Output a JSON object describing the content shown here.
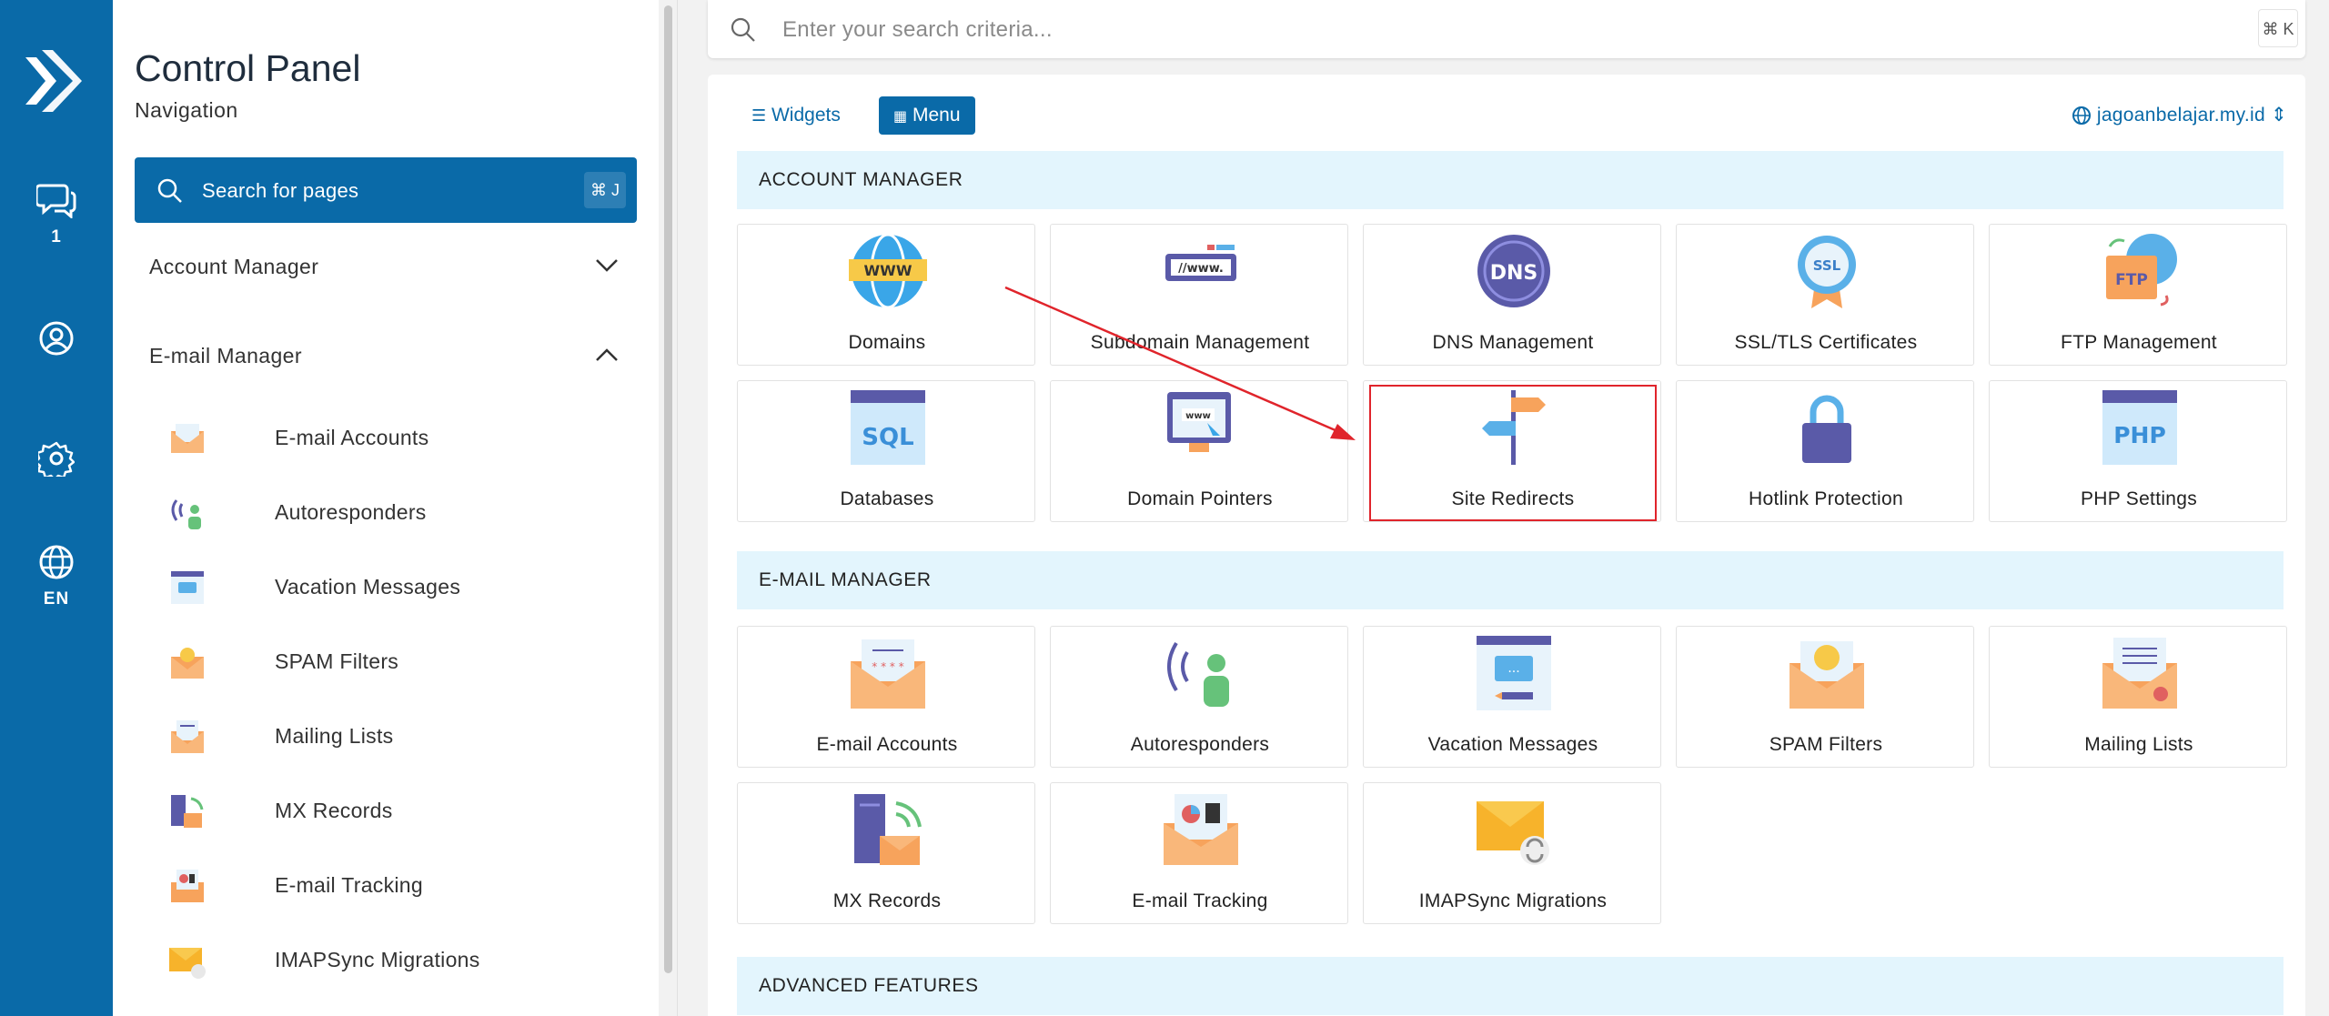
{
  "sidebar": {
    "title": "Control Panel",
    "subtitle": "Navigation",
    "search_placeholder": "Search for pages",
    "search_shortcut": "⌘ J",
    "sections": [
      {
        "label": "Account Manager",
        "expanded": false
      },
      {
        "label": "E-mail Manager",
        "expanded": true
      }
    ],
    "items": [
      {
        "label": "E-mail Accounts",
        "icon": "email-accounts-icon"
      },
      {
        "label": "Autoresponders",
        "icon": "autoresponder-icon"
      },
      {
        "label": "Vacation Messages",
        "icon": "vacation-messages-icon"
      },
      {
        "label": "SPAM Filters",
        "icon": "spam-filter-icon"
      },
      {
        "label": "Mailing Lists",
        "icon": "mailing-list-icon"
      },
      {
        "label": "MX Records",
        "icon": "mx-records-icon"
      },
      {
        "label": "E-mail Tracking",
        "icon": "email-tracking-icon"
      },
      {
        "label": "IMAPSync Migrations",
        "icon": "imapsync-icon"
      }
    ]
  },
  "rail": {
    "messages_count": "1",
    "language": "EN"
  },
  "topbar": {
    "search_placeholder": "Enter your search criteria...",
    "shortcut": "⌘ K"
  },
  "main": {
    "tabs": [
      {
        "label": "Widgets",
        "active": false
      },
      {
        "label": "Menu",
        "active": true
      }
    ],
    "domain": "jagoanbelajar.my.id",
    "sections": [
      {
        "title": "ACCOUNT MANAGER",
        "cards": [
          {
            "label": "Domains",
            "icon": "www-globe-icon"
          },
          {
            "label": "Subdomain Management",
            "icon": "subdomain-icon"
          },
          {
            "label": "DNS Management",
            "icon": "dns-icon"
          },
          {
            "label": "SSL/TLS Certificates",
            "icon": "ssl-badge-icon"
          },
          {
            "label": "FTP Management",
            "icon": "ftp-folder-icon"
          },
          {
            "label": "Databases",
            "icon": "sql-database-icon"
          },
          {
            "label": "Domain Pointers",
            "icon": "domain-pointer-icon"
          },
          {
            "label": "Site Redirects",
            "icon": "signpost-icon"
          },
          {
            "label": "Hotlink Protection",
            "icon": "padlock-icon"
          },
          {
            "label": "PHP Settings",
            "icon": "php-icon"
          }
        ]
      },
      {
        "title": "E-MAIL MANAGER",
        "cards": [
          {
            "label": "E-mail Accounts",
            "icon": "email-accounts-icon"
          },
          {
            "label": "Autoresponders",
            "icon": "autoresponder-icon"
          },
          {
            "label": "Vacation Messages",
            "icon": "vacation-messages-icon"
          },
          {
            "label": "SPAM Filters",
            "icon": "spam-filter-icon"
          },
          {
            "label": "Mailing Lists",
            "icon": "mailing-list-icon"
          },
          {
            "label": "MX Records",
            "icon": "mx-records-icon"
          },
          {
            "label": "E-mail Tracking",
            "icon": "email-tracking-icon"
          },
          {
            "label": "IMAPSync Migrations",
            "icon": "imapsync-icon"
          }
        ]
      },
      {
        "title": "ADVANCED FEATURES",
        "cards": []
      }
    ]
  },
  "colors": {
    "brand": "#0a6aa8",
    "section_bg": "#e3f5fd",
    "highlight": "#e0242b"
  }
}
